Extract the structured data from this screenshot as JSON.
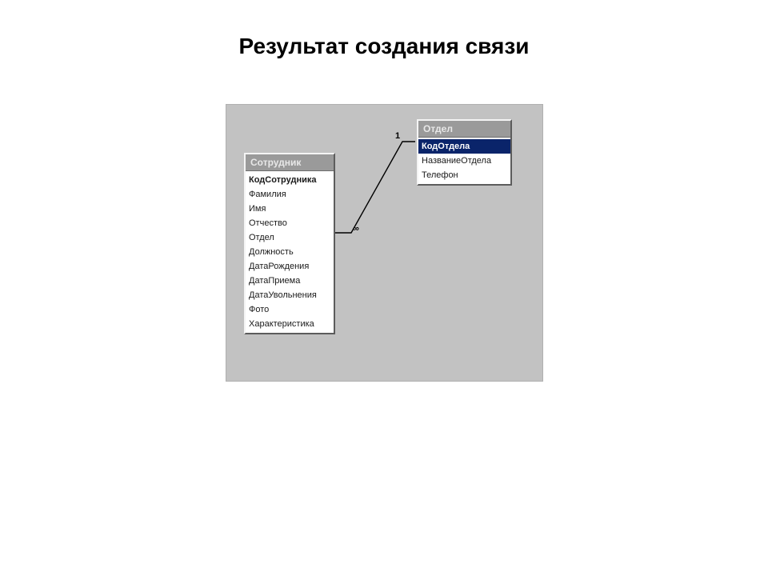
{
  "title": "Результат создания связи",
  "tables": {
    "employee": {
      "title": "Сотрудник",
      "fields": [
        {
          "name": "КодСотрудника",
          "pk": true,
          "selected": false
        },
        {
          "name": "Фамилия",
          "pk": false,
          "selected": false
        },
        {
          "name": "Имя",
          "pk": false,
          "selected": false
        },
        {
          "name": "Отчество",
          "pk": false,
          "selected": false
        },
        {
          "name": "Отдел",
          "pk": false,
          "selected": false
        },
        {
          "name": "Должность",
          "pk": false,
          "selected": false
        },
        {
          "name": "ДатаРождения",
          "pk": false,
          "selected": false
        },
        {
          "name": "ДатаПриема",
          "pk": false,
          "selected": false
        },
        {
          "name": "ДатаУвольнения",
          "pk": false,
          "selected": false
        },
        {
          "name": "Фото",
          "pk": false,
          "selected": false
        },
        {
          "name": "Характеристика",
          "pk": false,
          "selected": false
        }
      ]
    },
    "department": {
      "title": "Отдел",
      "fields": [
        {
          "name": "КодОтдела",
          "pk": true,
          "selected": true
        },
        {
          "name": "НазваниеОтдела",
          "pk": false,
          "selected": false
        },
        {
          "name": "Телефон",
          "pk": false,
          "selected": false
        }
      ]
    }
  },
  "relation": {
    "from_table": "employee",
    "from_field": "Отдел",
    "to_table": "department",
    "to_field": "КодОтдела",
    "from_label": "∞",
    "to_label": "1"
  }
}
